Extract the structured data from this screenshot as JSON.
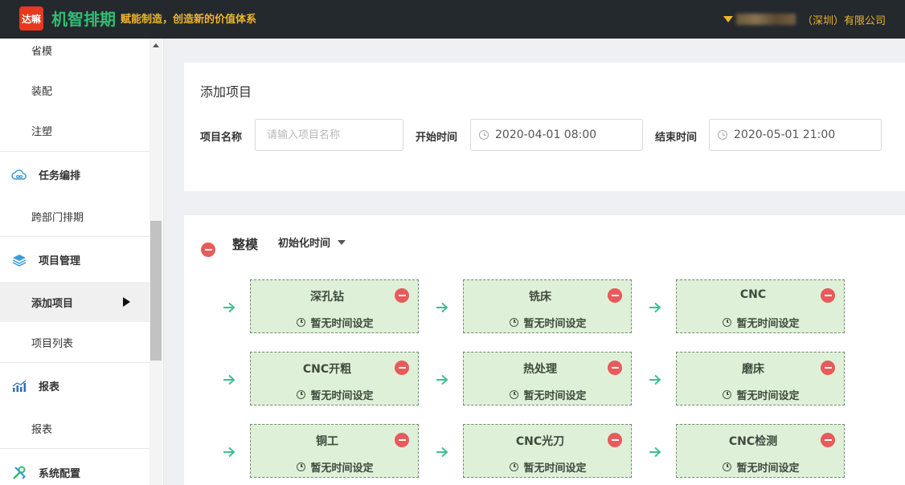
{
  "header": {
    "logo_text": "达嘛",
    "app_name": "机智排期",
    "slogan": "赋能制造，创造新的价值体系",
    "company_suffix": "（深圳）有限公司"
  },
  "sidebar": {
    "items": [
      {
        "label": "省模"
      },
      {
        "label": "装配"
      },
      {
        "label": "注塑"
      },
      {
        "label": "任务编排",
        "icon": "cloud-icon"
      },
      {
        "label": "跨部门排期"
      },
      {
        "label": "项目管理",
        "icon": "layers-icon"
      },
      {
        "label": "添加项目",
        "active": true
      },
      {
        "label": "项目列表"
      },
      {
        "label": "报表",
        "icon": "chart-icon"
      },
      {
        "label": "报表"
      },
      {
        "label": "系统配置",
        "icon": "tools-icon"
      }
    ]
  },
  "form": {
    "title": "添加项目",
    "project_name_label": "项目名称",
    "project_name_placeholder": "请输入项目名称",
    "start_label": "开始时间",
    "start_value": "2020-04-01 08:00",
    "end_label": "结束时间",
    "end_value": "2020-05-01 21:00"
  },
  "section": {
    "title": "整模",
    "init_time_label": "初始化时间",
    "no_time_text": "暂无时间设定",
    "steps": [
      {
        "name": "深孔钻"
      },
      {
        "name": "铣床"
      },
      {
        "name": "CNC"
      },
      {
        "name": "CNC开粗"
      },
      {
        "name": "热处理"
      },
      {
        "name": "磨床"
      },
      {
        "name": "铜工"
      },
      {
        "name": "CNC光刀"
      },
      {
        "name": "CNC检测"
      }
    ]
  },
  "colors": {
    "header_bg": "#24292e",
    "brand_green": "#2fbf71",
    "accent_gold": "#f0b42c",
    "card_bg": "#dff0d8",
    "remove_red": "#e75b5b",
    "arrow_teal": "#3fbf8f"
  }
}
